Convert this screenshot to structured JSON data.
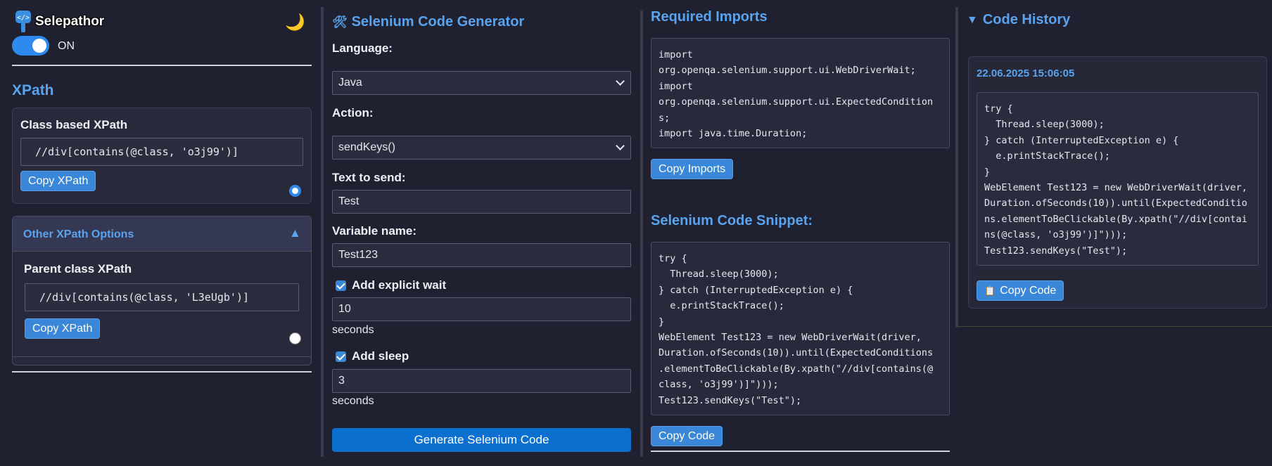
{
  "brand": {
    "name": "Selepathor",
    "icon": "code-wrench-icon"
  },
  "theme_toggle": {
    "icon": "moon-icon",
    "glyph": "🌙"
  },
  "power": {
    "label": "ON",
    "enabled": true
  },
  "xpath": {
    "heading": "XPath",
    "class_based": {
      "title": "Class based XPath",
      "value": "//div[contains(@class, 'o3j99')]",
      "copy_label": "Copy XPath",
      "selected": true
    },
    "other": {
      "title": "Other XPath Options",
      "expanded": true,
      "toggle_glyph": "▲",
      "parent": {
        "title": "Parent class XPath",
        "value": "//div[contains(@class, 'L3eUgb')]",
        "copy_label": "Copy XPath",
        "selected": false
      }
    }
  },
  "generator": {
    "title": "Selenium Code Generator",
    "title_glyph": "🛠",
    "language_label": "Language:",
    "language_value": "Java",
    "action_label": "Action:",
    "action_value": "sendKeys()",
    "text_label": "Text to send:",
    "text_value": "Test",
    "variable_label": "Variable name:",
    "variable_value": "Test123",
    "explicit_wait_label": "Add explicit wait",
    "explicit_wait_checked": true,
    "explicit_wait_value": "10",
    "explicit_wait_unit": "seconds",
    "sleep_label": "Add sleep",
    "sleep_checked": true,
    "sleep_value": "3",
    "sleep_unit": "seconds",
    "generate_label": "Generate Selenium Code"
  },
  "imports": {
    "title": "Required Imports",
    "code": "import\norg.openqa.selenium.support.ui.WebDriverWait;\nimport\norg.openqa.selenium.support.ui.ExpectedCondition\ns;\nimport java.time.Duration;",
    "copy_label": "Copy Imports"
  },
  "snippet": {
    "title": "Selenium Code Snippet:",
    "code": "try {\n  Thread.sleep(3000);\n} catch (InterruptedException e) {\n  e.printStackTrace();\n}\nWebElement Test123 = new WebDriverWait(driver,\nDuration.ofSeconds(10)).until(ExpectedConditions\n.elementToBeClickable(By.xpath(\"//div[contains(@\nclass, 'o3j99')]\")));\nTest123.sendKeys(\"Test\");",
    "copy_label": "Copy Code"
  },
  "history": {
    "title": "Code History",
    "toggle_glyph": "▼",
    "entries": [
      {
        "timestamp": "22.06.2025 15:06:05",
        "code": "try {\n  Thread.sleep(3000);\n} catch (InterruptedException e) {\n  e.printStackTrace();\n}\nWebElement Test123 = new WebDriverWait(driver,\nDuration.ofSeconds(10)).until(ExpectedConditio\nns.elementToBeClickable(By.xpath(\"//div[contai\nns(@class, 'o3j99')]\")));\nTest123.sendKeys(\"Test\");",
        "copy_label": "Copy Code",
        "copy_icon": "clipboard-icon",
        "copy_glyph": "📋"
      }
    ]
  },
  "colors": {
    "background": "#1f2030",
    "accent": "#3a86d8",
    "heading_blue": "#5aa3ee",
    "card": "#282a3b"
  }
}
